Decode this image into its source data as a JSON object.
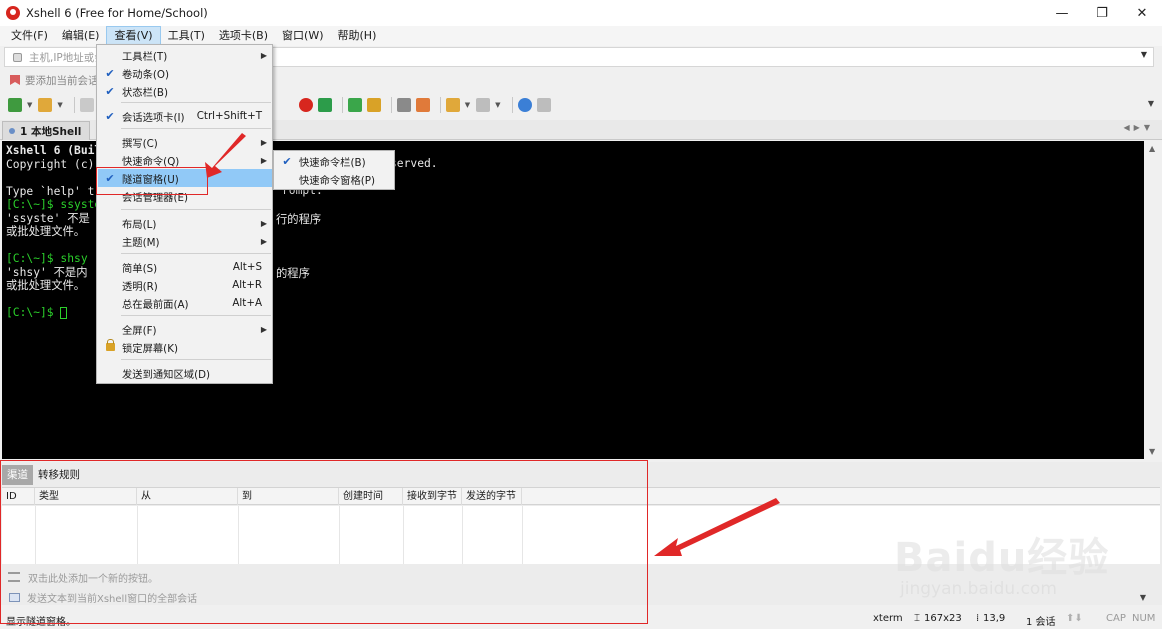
{
  "window": {
    "title": "Xshell 6 (Free for Home/School)",
    "minimize": "—",
    "maximize": "❐",
    "close": "✕"
  },
  "menubar": [
    "文件(F)",
    "编辑(E)",
    "查看(V)",
    "工具(T)",
    "选项卡(B)",
    "窗口(W)",
    "帮助(H)"
  ],
  "address": {
    "placeholder": "主机,IP地址或会"
  },
  "linkbar": {
    "text": "要添加当前会话"
  },
  "session_tab": {
    "label": "1 本地Shell"
  },
  "terminal": {
    "lines": [
      "Xshell 6 (Buil",
      "Copyright (c)",
      "",
      "Type `help' t",
      "[C:\\~]$ ssyste",
      "'ssyste' 不是",
      "或批处理文件。",
      "",
      "[C:\\~]$ shsy",
      "'shsy' 不是内",
      "或批处理文件。",
      "",
      "[C:\\~]$ "
    ],
    "right_fragments": {
      "line2": "served.",
      "line4": "rompt.",
      "line6": "行的程序",
      "line10": "的程序"
    }
  },
  "view_menu": {
    "items": [
      {
        "label": "工具栏(T)",
        "checked": false,
        "shortcut": "",
        "submenu": true
      },
      {
        "label": "卷动条(O)",
        "checked": true,
        "shortcut": "",
        "submenu": false
      },
      {
        "label": "状态栏(B)",
        "checked": true,
        "shortcut": "",
        "submenu": false
      },
      {
        "label": "会话选项卡(I)",
        "checked": true,
        "shortcut": "Ctrl+Shift+T",
        "submenu": false
      },
      {
        "label": "撰写(C)",
        "checked": false,
        "shortcut": "",
        "submenu": true
      },
      {
        "label": "快速命令(Q)",
        "checked": false,
        "shortcut": "",
        "submenu": true
      },
      {
        "label": "隧道窗格(U)",
        "checked": true,
        "shortcut": "",
        "submenu": false
      },
      {
        "label": "会话管理器(E)",
        "checked": false,
        "shortcut": "",
        "submenu": false
      },
      {
        "label": "布局(L)",
        "checked": false,
        "shortcut": "",
        "submenu": true
      },
      {
        "label": "主题(M)",
        "checked": false,
        "shortcut": "",
        "submenu": true
      },
      {
        "label": "简单(S)",
        "checked": false,
        "shortcut": "Alt+S",
        "submenu": false
      },
      {
        "label": "透明(R)",
        "checked": false,
        "shortcut": "Alt+R",
        "submenu": false
      },
      {
        "label": "总在最前面(A)",
        "checked": false,
        "shortcut": "Alt+A",
        "submenu": false
      },
      {
        "label": "全屏(F)",
        "checked": false,
        "shortcut": "",
        "submenu": true
      },
      {
        "label": "锁定屏幕(K)",
        "checked": false,
        "shortcut": "",
        "submenu": false
      },
      {
        "label": "发送到通知区域(D)",
        "checked": false,
        "shortcut": "",
        "submenu": false
      }
    ]
  },
  "quick_submenu": {
    "items": [
      {
        "label": "快速命令栏(B)",
        "checked": true
      },
      {
        "label": "快速命令窗格(P)",
        "checked": false
      }
    ]
  },
  "tunnel": {
    "tabs": [
      "渠道",
      "转移规则"
    ],
    "columns": [
      "ID",
      "类型",
      "从",
      "到",
      "创建时间",
      "接收到字节",
      "发送的字节"
    ],
    "add_button_hint": "双击此处添加一个新的按钮。",
    "send_hint": "发送文本到当前Xshell窗口的全部会话"
  },
  "status": {
    "message": "显示隧道窗格。",
    "term": "xterm",
    "size": "167x23",
    "pos": "13,9",
    "sessions": "1 会话",
    "caps": "CAP",
    "num": "NUM"
  },
  "watermark": {
    "line1": "Baidu经验",
    "line2": "jingyan.baidu.com"
  },
  "colors": {
    "accent": "#d7261e",
    "highlight": "#91c9f7",
    "annotation": "#e02828",
    "terminal_green": "#2bd02b"
  }
}
